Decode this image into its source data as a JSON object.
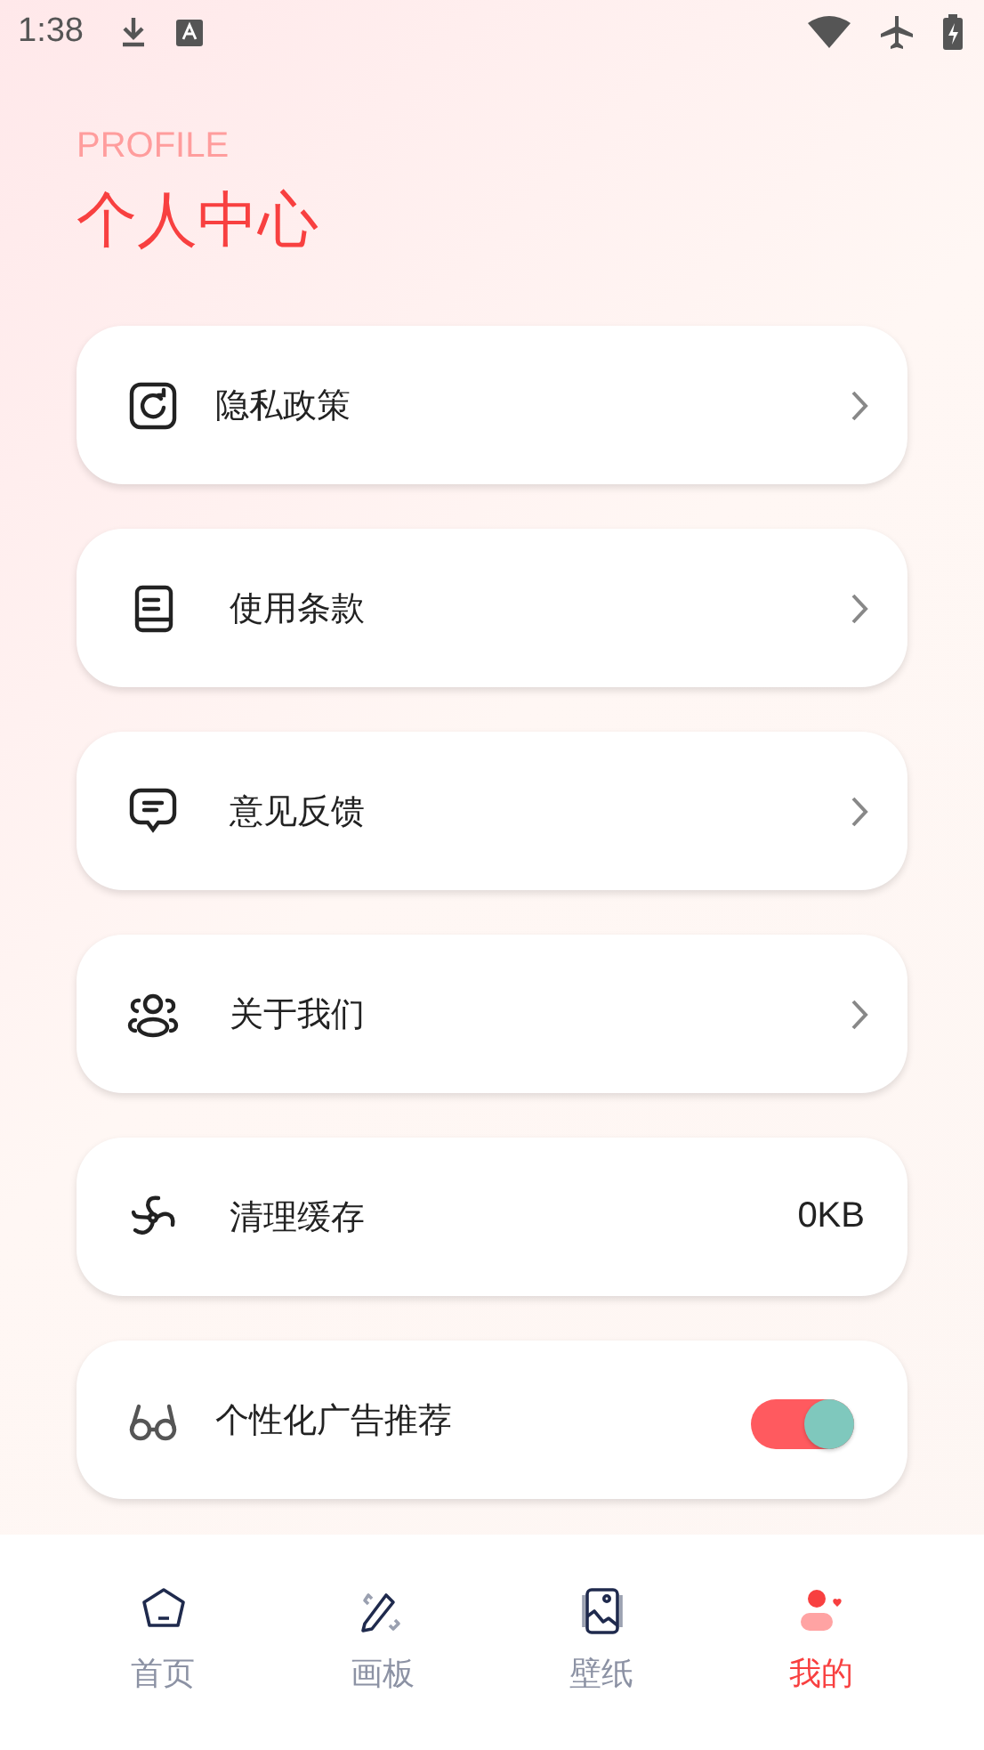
{
  "status_bar": {
    "time": "1:38"
  },
  "header": {
    "overline": "PROFILE",
    "title": "个人中心"
  },
  "settings": [
    {
      "kind": "link",
      "label": "隐私政策"
    },
    {
      "kind": "link",
      "label": "使用条款"
    },
    {
      "kind": "link",
      "label": "意见反馈"
    },
    {
      "kind": "link",
      "label": "关于我们"
    },
    {
      "kind": "value",
      "label": "清理缓存",
      "value": "0KB"
    },
    {
      "kind": "toggle",
      "label": "个性化广告推荐",
      "on": true
    }
  ],
  "tab_bar": [
    {
      "label": "首页",
      "selected": false
    },
    {
      "label": "画板",
      "selected": false
    },
    {
      "label": "壁纸",
      "selected": false
    },
    {
      "label": "我的",
      "selected": true
    }
  ]
}
